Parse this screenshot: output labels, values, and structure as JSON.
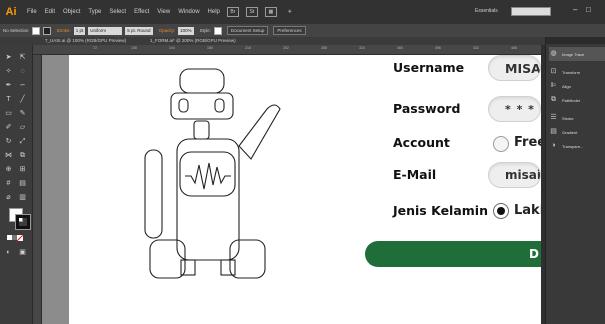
{
  "app": {
    "logo": "Ai",
    "menu": [
      "File",
      "Edit",
      "Object",
      "Type",
      "Select",
      "Effect",
      "View",
      "Window",
      "Help"
    ],
    "workspace": "Essentials",
    "window_controls": [
      "–",
      "□"
    ]
  },
  "control_bar": {
    "selection": "No Selection",
    "stroke_label": "Stroke:",
    "stroke_weight": "1 pt",
    "profile": "Uniform",
    "brush": "5 pt. Round",
    "opacity_label": "Opacity:",
    "opacity": "100%",
    "style_label": "Style:",
    "document_setup": "Document Setup",
    "preferences": "Preferences"
  },
  "tabs": [
    "7_UASI.ai @ 100% (RGB/GPU Preview)",
    "1_FORM.ai* @ 200% (RGB/GPU Preview)"
  ],
  "ruler_ticks": [
    "72",
    "108",
    "144",
    "180",
    "216",
    "252",
    "288",
    "324",
    "360",
    "396",
    "432",
    "468",
    "504"
  ],
  "form": {
    "username_label": "Username",
    "username_value": "MISAIWAI",
    "password_label": "Password",
    "password_value": "* * * * * * *",
    "account_label": "Account",
    "account_option": "Free",
    "email_label": "E-Mail",
    "email_value": "misaiwan@",
    "gender_label": "Jenis Kelamin",
    "gender_option": "Laki",
    "button_label": "D"
  },
  "panels": [
    "Image Trace",
    "Transform",
    "Align",
    "Pathfinder",
    "Stroke",
    "Gradient",
    "Transpare..."
  ],
  "colors": {
    "accent_orange": "#ff9a00",
    "button_green": "#1f6e3a",
    "ui_dark": "#323232"
  }
}
